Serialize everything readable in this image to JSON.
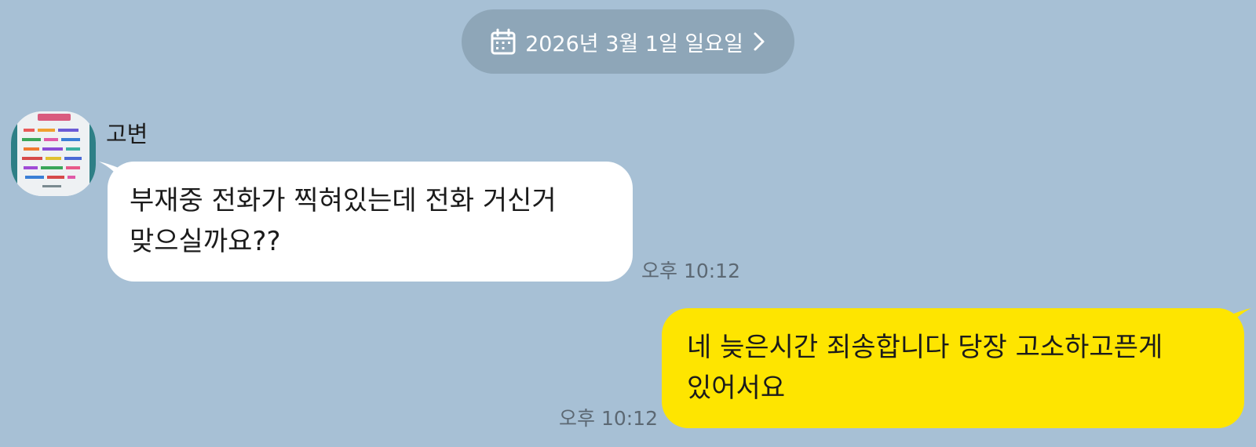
{
  "date_header": {
    "label": "2026년 3월 1일 일요일",
    "calendar_icon": "calendar-icon",
    "chevron_icon": "chevron-right-icon"
  },
  "incoming": {
    "sender": "고변",
    "lines": [
      "부재중 전화가 찍혀있는데 전화 거신거",
      "맞으실까요??"
    ],
    "time": "오후 10:12",
    "bubble_color": "#ffffff"
  },
  "outgoing": {
    "lines": [
      "네 늦은시간 죄송합니다 당장 고소하고픈게",
      "있어서요"
    ],
    "time": "오후 10:12",
    "bubble_color": "#fee500"
  },
  "colors": {
    "background": "#a7c0d5",
    "date_pill": "#8ea6b8",
    "timestamp": "#5c6873"
  }
}
